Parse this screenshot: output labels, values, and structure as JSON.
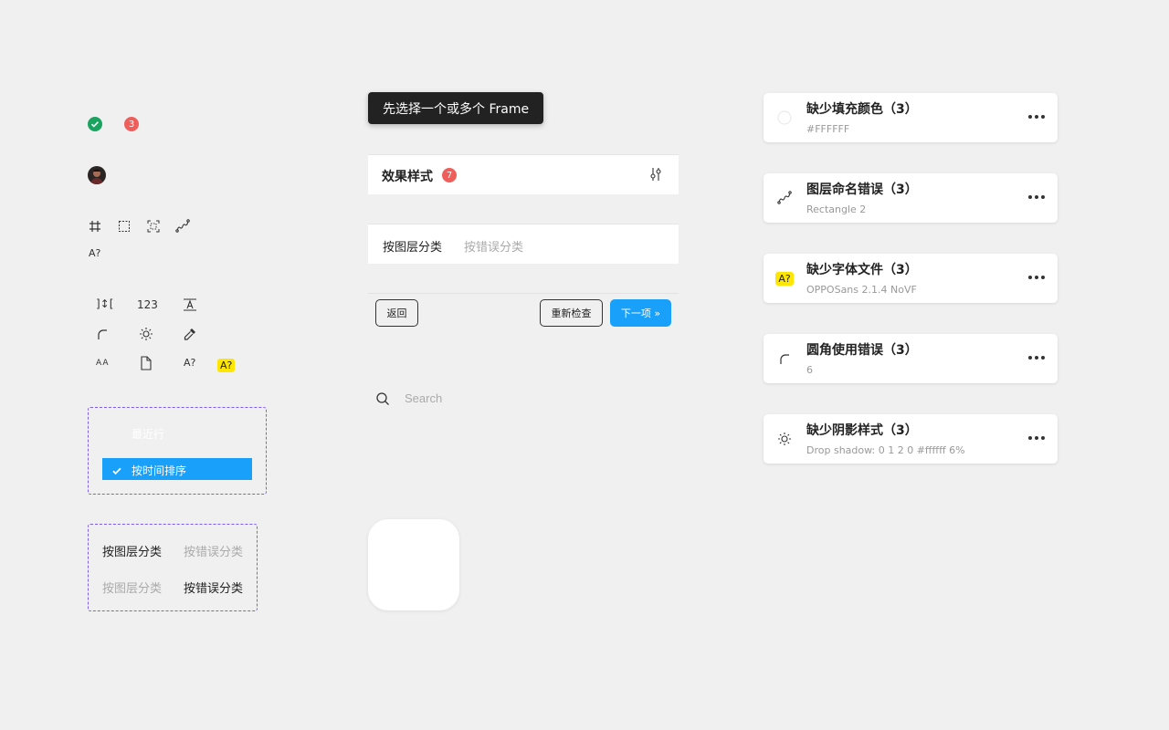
{
  "status": {
    "badge_count": "3",
    "green": "#1aa35f",
    "red": "#ee5f5b"
  },
  "icons_small": {
    "font_missing_label": "A?"
  },
  "icons_grid": {
    "numbers": "123",
    "aa": "AA",
    "a_question": "A?",
    "a_question_highlight": "A?"
  },
  "sort_dropdown": {
    "hidden_item": "最近行",
    "selected_item": "按时间排序"
  },
  "tabs_demo": {
    "row1": {
      "active": "按图层分类",
      "inactive": "按错误分类"
    },
    "row2": {
      "inactive": "按图层分类",
      "active": "按错误分类"
    }
  },
  "tooltip": {
    "text": "先选择一个或多个 Frame"
  },
  "effect_header": {
    "title": "效果样式",
    "count": "7"
  },
  "group_tabs": {
    "by_layer": "按图层分类",
    "by_error": "按错误分类"
  },
  "actions": {
    "back": "返回",
    "recheck": "重新检查",
    "next": "下一项 »"
  },
  "search": {
    "placeholder": "Search"
  },
  "cards": [
    {
      "title": "缺少填充颜色（3）",
      "subtitle": "#FFFFFF",
      "icon": "circle-icon"
    },
    {
      "title": "图层命名错误（3）",
      "subtitle": "Rectangle 2",
      "icon": "vector-path-icon"
    },
    {
      "title": "缺少字体文件（3）",
      "subtitle": "OPPOSans 2.1.4 NoVF",
      "icon": "font-missing-icon",
      "icon_label": "A?"
    },
    {
      "title": "圆角使用错误（3）",
      "subtitle": "6",
      "icon": "corner-radius-icon"
    },
    {
      "title": "缺少阴影样式（3）",
      "subtitle": "Drop shadow: 0 1 2 0 #ffffff 6%",
      "icon": "sun-icon"
    }
  ],
  "colors": {
    "accent": "#18a0fb",
    "badge_red": "#ee5f5b",
    "highlight_yellow": "#ffe600",
    "dash_purple": "#7a5cf0",
    "tooltip_bg": "#222222"
  }
}
